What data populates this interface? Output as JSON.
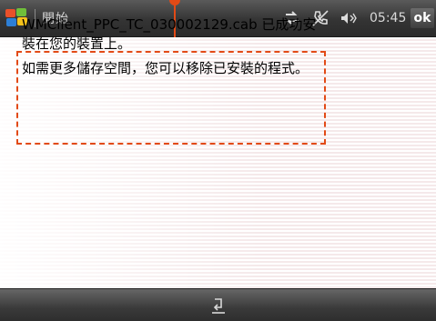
{
  "header": {
    "title": "開始",
    "time": "05:45",
    "ok_label": "ok",
    "status_icons": [
      "connectivity-icon",
      "no-phone-signal-icon",
      "volume-icon"
    ]
  },
  "message": {
    "line1": "WMClient_PPC_TC_030002129.cab 已成功安裝在您的裝置上。",
    "line2": "如需更多儲存空間，您可以移除已安裝的程式。"
  },
  "footer": {
    "keyboard_icon": "input-panel-icon"
  },
  "colors": {
    "annotation": "#e24a16",
    "bar_dark": "#3a3a3a"
  }
}
